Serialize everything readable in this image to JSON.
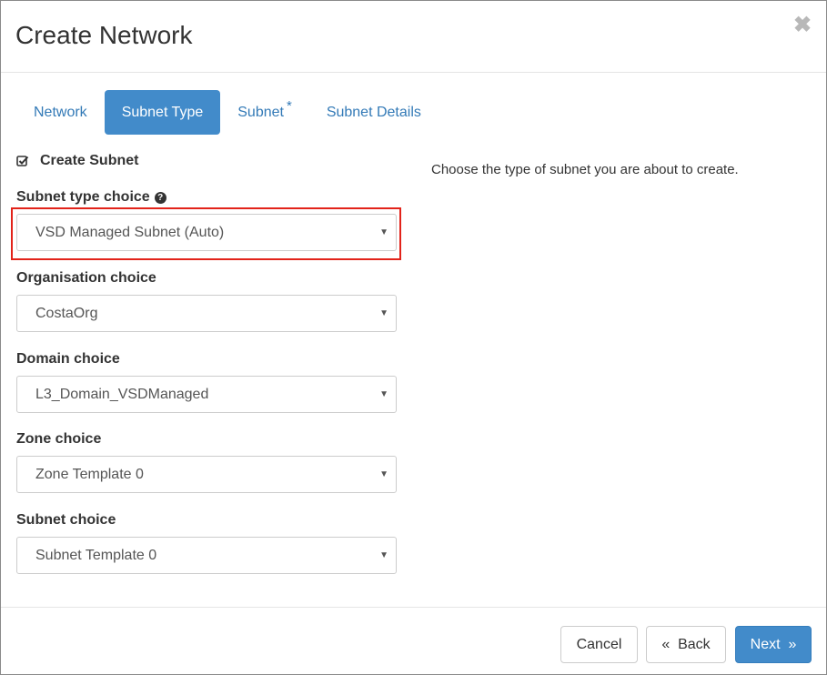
{
  "dialog": {
    "title": "Create Network",
    "close_glyph": "✖"
  },
  "tabs": [
    {
      "label": "Network",
      "active": false,
      "required": false
    },
    {
      "label": "Subnet Type",
      "active": true,
      "required": false
    },
    {
      "label": "Subnet",
      "active": false,
      "required": true,
      "required_mark": "*"
    },
    {
      "label": "Subnet Details",
      "active": false,
      "required": false
    }
  ],
  "form": {
    "create_subnet": {
      "label": "Create Subnet",
      "checked": true
    },
    "subnet_type": {
      "label": "Subnet type choice",
      "help_glyph": "?",
      "value": "VSD Managed Subnet (Auto)",
      "highlighted": true
    },
    "organisation": {
      "label": "Organisation choice",
      "value": "CostaOrg"
    },
    "domain": {
      "label": "Domain choice",
      "value": "L3_Domain_VSDManaged"
    },
    "zone": {
      "label": "Zone choice",
      "value": "Zone Template 0"
    },
    "subnet": {
      "label": "Subnet choice",
      "value": "Subnet Template 0"
    },
    "caret_glyph": "▼"
  },
  "help_text": "Choose the type of subnet you are about to create.",
  "footer": {
    "cancel_label": "Cancel",
    "back_label": "«  Back",
    "next_label": "Next  »"
  },
  "colors": {
    "primary": "#428bca",
    "link": "#337ab7",
    "highlight_border": "#e2231a"
  },
  "icons": {
    "close": "close-icon",
    "checkbox": "checkbox-checked-icon",
    "help": "question-circle-icon",
    "caret": "caret-down-icon"
  }
}
